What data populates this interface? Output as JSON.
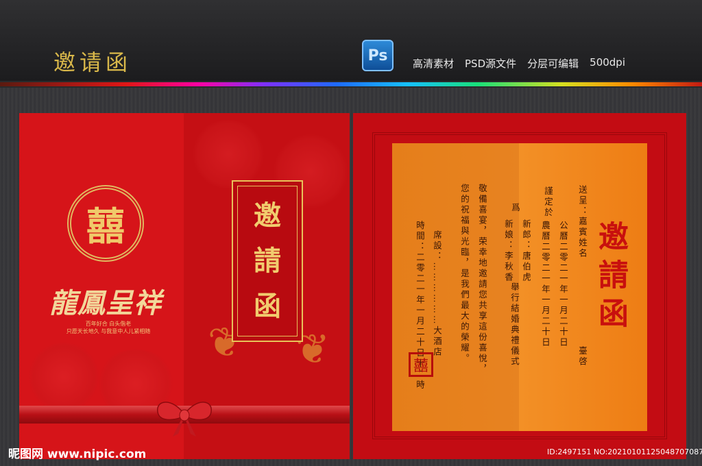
{
  "header": {
    "title": "邀请函",
    "ps_badge": "Ps",
    "features": [
      "高清素材",
      "PSD源文件",
      "分层可编辑",
      "500dpi"
    ]
  },
  "front_cover": {
    "emblem_char": "囍",
    "slogan": "龍鳳呈祥",
    "small_lines": [
      "百年好合 白头偕老",
      "只愿天长地久 与我意中人儿紧相随"
    ],
    "title_chars": [
      "邀",
      "請",
      "函"
    ]
  },
  "inside": {
    "title": "邀請函",
    "to": "送呈：",
    "guest": "嘉賓姓名",
    "seat": "臺啓",
    "date_label": "謹定於",
    "date_solar": "公曆二零二一年一月二十日",
    "date_lunar": "農曆二零二一年一月二十日",
    "groom": "新郎：唐伯虎",
    "bride": "新娘：李秋香",
    "hold": "爲",
    "ceremony": "舉行結婚典禮儀式",
    "respect_line": "敬備喜宴，荣幸地邀請您共享這份喜悅，",
    "visit_line": "您的祝福與光臨，是我們最大的榮耀。",
    "venue": "席設：………………大酒店",
    "time": "時間：二零二一年一月二十日十二時",
    "seal_char": "囍"
  },
  "footer": {
    "watermark": "昵图网 www.nipic.com",
    "id_text": "ID:2497151 NO:20210101125048707087"
  }
}
